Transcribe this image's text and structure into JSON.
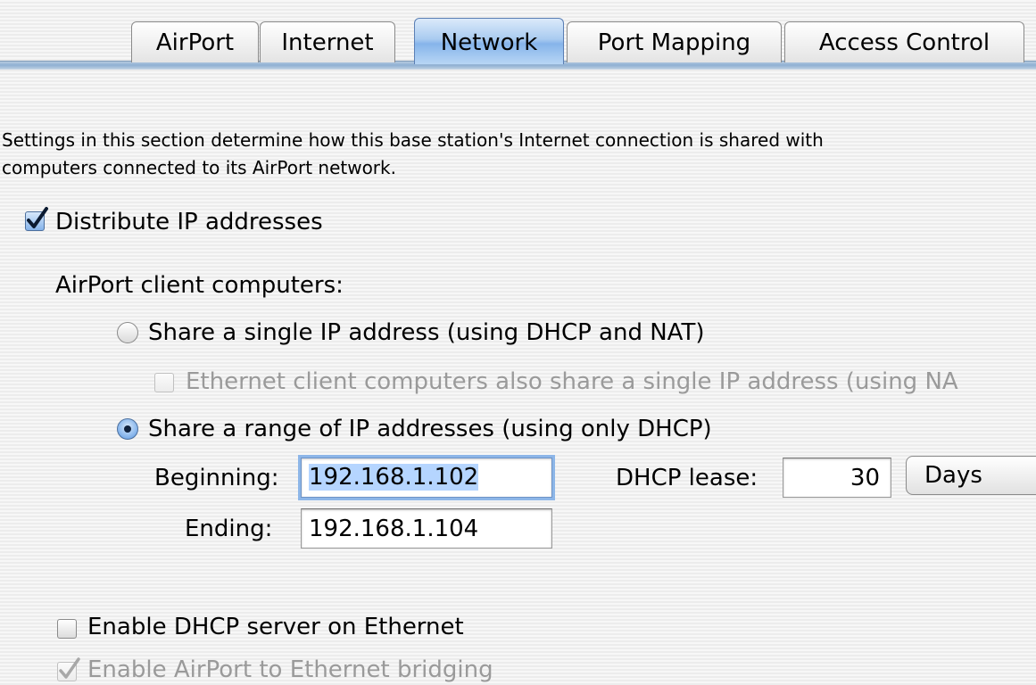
{
  "tabs": [
    {
      "label": "AirPort",
      "selected": false
    },
    {
      "label": "Internet",
      "selected": false
    },
    {
      "label": "Network",
      "selected": true
    },
    {
      "label": "Port Mapping",
      "selected": false
    },
    {
      "label": "Access Control",
      "selected": false
    }
  ],
  "description": {
    "line1": "Settings in this section determine how this base station's Internet connection is shared with",
    "line2": "computers connected to its AirPort network."
  },
  "distribute_ip": {
    "label": "Distribute IP addresses",
    "checked": true
  },
  "client_section": {
    "label": "AirPort client computers:"
  },
  "share_single": {
    "label": "Share a single IP address (using DHCP and NAT)",
    "selected": false
  },
  "ethernet_share": {
    "label": "Ethernet client computers also share a single IP address (using NA",
    "checked": false,
    "enabled": false
  },
  "share_range": {
    "label": "Share a range of IP addresses (using only DHCP)",
    "selected": true
  },
  "beginning": {
    "label": "Beginning:",
    "value": "192.168.1.102"
  },
  "ending": {
    "label": "Ending:",
    "value": "192.168.1.104"
  },
  "dhcp_lease": {
    "label": "DHCP lease:",
    "value": "30",
    "unit": "Days"
  },
  "enable_dhcp_ethernet": {
    "label": "Enable DHCP server on Ethernet",
    "checked": false
  },
  "enable_bridging": {
    "label": "Enable AirPort to Ethernet bridging",
    "checked": true,
    "enabled": false
  },
  "colors": {
    "selected_tab": "#86b4ea",
    "focus_ring": "#8db6e8",
    "disabled_text": "#9a9a9a"
  }
}
